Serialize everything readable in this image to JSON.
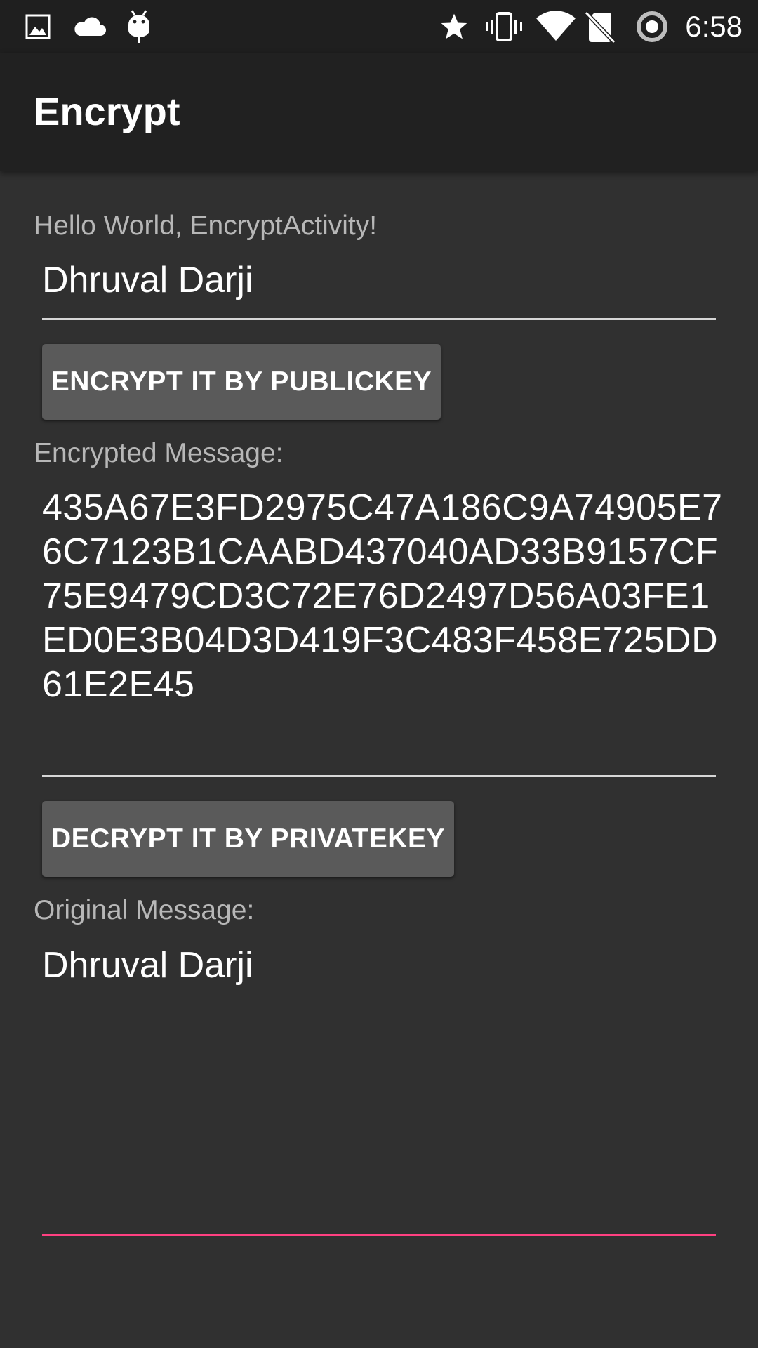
{
  "status_bar": {
    "time": "6:58",
    "left_icons": [
      "image-icon",
      "cloud-icon",
      "android-icon"
    ],
    "right_icons": [
      "star-icon",
      "vibrate-icon",
      "wifi-icon",
      "no-sim-icon",
      "sync-icon"
    ]
  },
  "app_bar": {
    "title": "Encrypt"
  },
  "content": {
    "greeting": "Hello World, EncryptActivity!",
    "input_value": "Dhruval Darji",
    "encrypt_button_label": "ENCRYPT IT BY PUBLICKEY",
    "encrypted_label": "Encrypted Message:",
    "encrypted_value": "435A67E3FD2975C47A186C9A74905E76C7123B1CAABD437040AD33B9157CF75E9479CD3C72E76D2497D56A03FE1ED0E3B04D3D419F3C483F458E725DD61E2E45",
    "decrypt_button_label": "DECRYPT IT BY PRIVATEKEY",
    "original_label": "Original Message:",
    "original_value": "Dhruval Darji"
  },
  "colors": {
    "background": "#303030",
    "app_bar": "#212121",
    "status_bar": "#1f1f1f",
    "button": "#5a5a5a",
    "accent": "#ff4081"
  }
}
